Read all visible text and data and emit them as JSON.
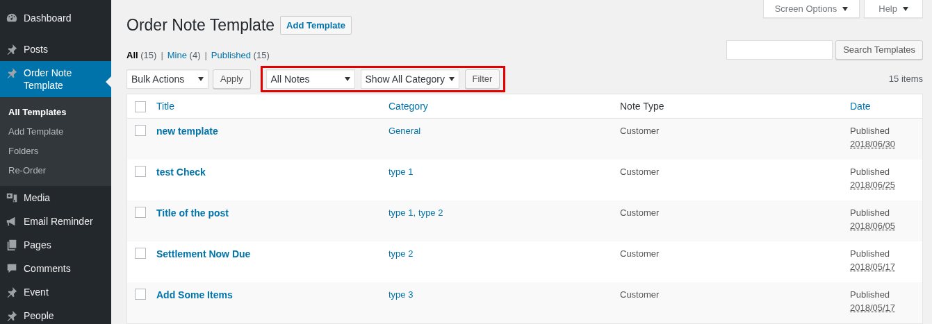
{
  "sidebar": {
    "items": [
      {
        "label": "Dashboard",
        "selected": false
      },
      {
        "label": "Posts",
        "selected": false
      },
      {
        "label": "Order Note Template",
        "selected": true,
        "children": [
          {
            "label": "All Templates",
            "selected": true
          },
          {
            "label": "Add Template",
            "selected": false
          },
          {
            "label": "Folders",
            "selected": false
          },
          {
            "label": "Re-Order",
            "selected": false
          }
        ]
      },
      {
        "label": "Media",
        "selected": false
      },
      {
        "label": "Email Reminder",
        "selected": false
      },
      {
        "label": "Pages",
        "selected": false
      },
      {
        "label": "Comments",
        "selected": false
      },
      {
        "label": "Event",
        "selected": false
      },
      {
        "label": "People",
        "selected": false
      }
    ]
  },
  "top_tabs": [
    "Screen Options",
    "Help"
  ],
  "page_title": "Order Note Template",
  "add_button": "Add Template",
  "views": [
    {
      "label": "All",
      "count": "(15)",
      "selected": true
    },
    {
      "separator": "|",
      "label": "Mine",
      "count": "(4)",
      "selected": false
    },
    {
      "separator": "|",
      "label": "Published",
      "count": "(15)",
      "selected": false
    }
  ],
  "search_button": "Search Templates",
  "bulk_select": "Bulk Actions",
  "apply_button": "Apply",
  "note_select": "All Notes",
  "category_select": "Show All Category",
  "filter_button": "Filter",
  "item_count": "15 items",
  "table": {
    "select_all_checked": false,
    "columns": [
      "Title",
      "Category",
      "Note Type",
      "Date"
    ],
    "rows": [
      {
        "checked": false,
        "title": "new template",
        "categories": [
          "General"
        ],
        "note_type": "Customer",
        "status": "Published",
        "date": "2018/06/30"
      },
      {
        "checked": false,
        "title": "test Check",
        "categories": [
          "type 1"
        ],
        "note_type": "Customer",
        "status": "Published",
        "date": "2018/06/25"
      },
      {
        "checked": false,
        "title": "Title of the post",
        "categories": [
          "type 1,",
          "type 2"
        ],
        "note_type": "Customer",
        "status": "Published",
        "date": "2018/06/05"
      },
      {
        "checked": false,
        "title": "Settlement Now Due",
        "categories": [
          "type 2"
        ],
        "note_type": "Customer",
        "status": "Published",
        "date": "2018/05/17"
      },
      {
        "checked": false,
        "title": "Add Some Items",
        "categories": [
          "type 3"
        ],
        "note_type": "Customer",
        "status": "Published",
        "date": "2018/05/17"
      }
    ]
  }
}
